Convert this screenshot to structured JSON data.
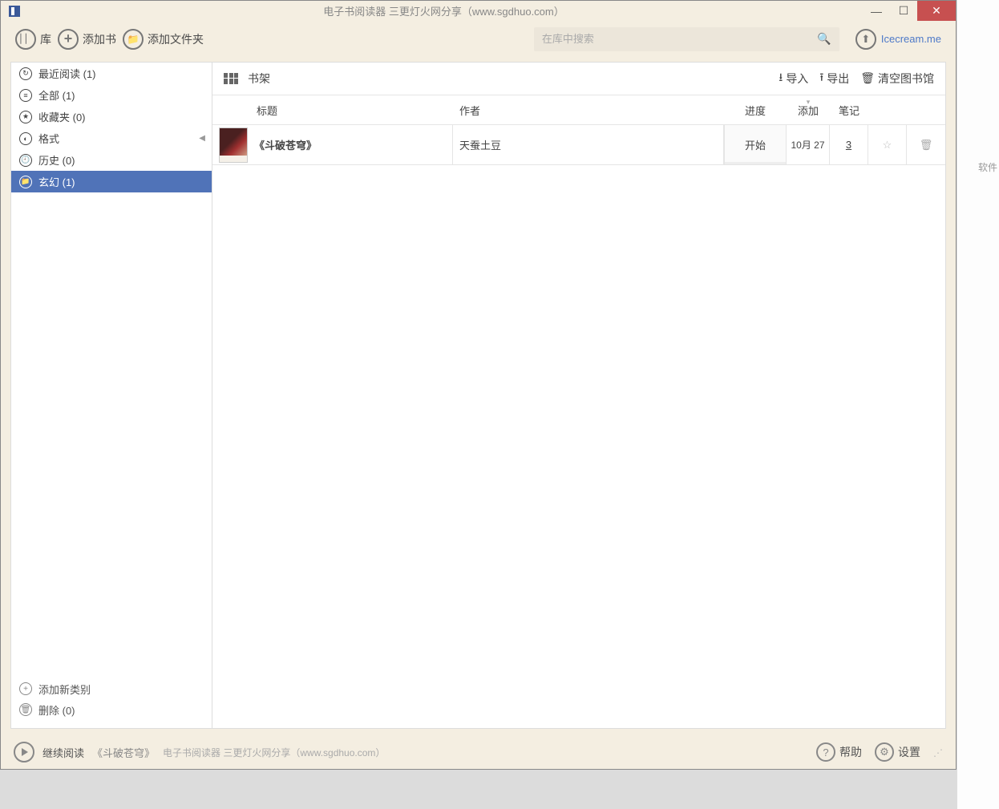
{
  "title": "电子书阅读器  三更灯火网分享（www.sgdhuo.com）",
  "toolbar": {
    "library": "库",
    "add_book": "添加书",
    "add_folder": "添加文件夹"
  },
  "search": {
    "placeholder": "在库中搜索"
  },
  "account_link": "Icecream.me",
  "sidebar": {
    "items": [
      {
        "label": "最近阅读 (1)",
        "glyph": "↻"
      },
      {
        "label": "全部 (1)",
        "glyph": "≡"
      },
      {
        "label": "收藏夹 (0)",
        "glyph": "★"
      },
      {
        "label": "格式",
        "glyph": "◐",
        "has_chevron": true
      },
      {
        "label": "历史 (0)",
        "glyph": "🕘"
      },
      {
        "label": "玄幻 (1)",
        "glyph": "📁",
        "selected": true
      }
    ],
    "add_category": "添加新类别",
    "delete": "删除 (0)"
  },
  "content": {
    "shelf_label": "书架",
    "import": "导入",
    "export": "导出",
    "clear": "清空图书馆",
    "columns": {
      "title": "标题",
      "author": "作者",
      "progress": "进度",
      "added": "添加",
      "notes": "笔记"
    },
    "rows": [
      {
        "title": "《斗破苍穹》",
        "author": "天蚕土豆",
        "progress": "开始",
        "added": "10月 27",
        "notes": "3"
      }
    ]
  },
  "status": {
    "continue": "继续阅读",
    "book": "《斗破苍穹》",
    "sub": "电子书阅读器  三更灯火网分享（www.sgdhuo.com）",
    "help": "帮助",
    "settings": "设置"
  },
  "bg_label": "软件"
}
